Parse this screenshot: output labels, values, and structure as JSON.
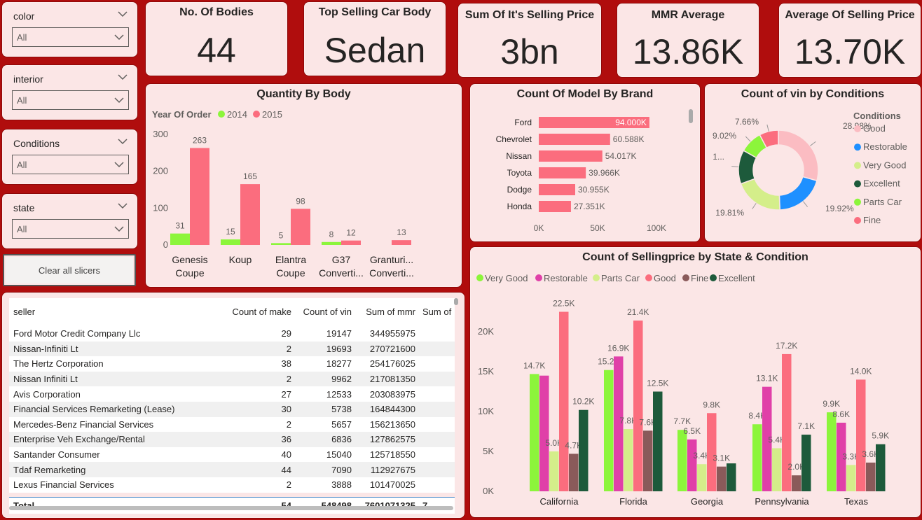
{
  "slicers": [
    {
      "title": "color",
      "value": "All"
    },
    {
      "title": "interior",
      "value": "All"
    },
    {
      "title": "Conditions",
      "value": "All"
    },
    {
      "title": "state",
      "value": "All"
    }
  ],
  "clear_button": "Clear all slicers",
  "kpis": [
    {
      "title": "No. Of Bodies",
      "value": "44"
    },
    {
      "title": "Top Selling Car Body",
      "value": "Sedan"
    },
    {
      "title": "Sum Of It's Selling Price",
      "value": "3bn"
    },
    {
      "title": "MMR Average",
      "value": "13.86K"
    },
    {
      "title": "Average Of Selling Price",
      "value": "13.70K"
    }
  ],
  "chart_data": [
    {
      "type": "bar",
      "title": "Quantity By Body",
      "legend_title": "Year Of Order",
      "categories": [
        "Genesis Coupe",
        "Koup",
        "Elantra Coupe",
        "G37 Converti...",
        "Granturi... Converti..."
      ],
      "category_lines": [
        [
          "Genesis",
          "Coupe"
        ],
        [
          "Koup"
        ],
        [
          "Elantra",
          "Coupe"
        ],
        [
          "G37",
          "Converti..."
        ],
        [
          "Granturi...",
          "Converti..."
        ]
      ],
      "series": [
        {
          "name": "2014",
          "color": "#8cf53b",
          "values": [
            31,
            15,
            5,
            8,
            0
          ],
          "labels": [
            "31",
            "15",
            "5",
            "8",
            ""
          ]
        },
        {
          "name": "2015",
          "color": "#fb6d7e",
          "values": [
            263,
            165,
            98,
            12,
            13
          ],
          "labels": [
            "263",
            "165",
            "98",
            "12",
            "13"
          ]
        }
      ],
      "yticks": [
        "0",
        "100",
        "200",
        "300"
      ],
      "ylim": [
        0,
        300
      ]
    },
    {
      "type": "bar",
      "orientation": "horizontal",
      "title": "Count Of Model By Brand",
      "categories": [
        "Ford",
        "Chevrolet",
        "Nissan",
        "Toyota",
        "Dodge",
        "Honda"
      ],
      "values": [
        94000,
        60588,
        54017,
        39966,
        30955,
        27351
      ],
      "labels": [
        "94.000K",
        "60.588K",
        "54.017K",
        "39.966K",
        "30.955K",
        "27.351K"
      ],
      "xticks": [
        "0K",
        "50K",
        "100K"
      ],
      "xlim": [
        0,
        100000
      ],
      "color": "#fb6d7e"
    },
    {
      "type": "pie",
      "title": "Count of vin by Conditions",
      "legend_title": "Conditions",
      "slices": [
        {
          "name": "Good",
          "value": 28.98,
          "label": "28.98%",
          "color": "#fbbcc2"
        },
        {
          "name": "Restorable",
          "value": 19.92,
          "label": "19.92%",
          "color": "#1e90ff"
        },
        {
          "name": "Very Good",
          "value": 19.81,
          "label": "19.81%",
          "color": "#d4ee8a"
        },
        {
          "name": "Excellent",
          "value": 13.61,
          "label": "1...",
          "color": "#1d5a3b"
        },
        {
          "name": "Parts Car",
          "value": 9.02,
          "label": "9.02%",
          "color": "#8cf53b"
        },
        {
          "name": "Fine",
          "value": 7.66,
          "label": "7.66%",
          "color": "#fb6d7e"
        }
      ]
    },
    {
      "type": "bar",
      "title": "Count of Sellingprice by State & Condition",
      "categories": [
        "California",
        "Florida",
        "Georgia",
        "Pennsylvania",
        "Texas"
      ],
      "series": [
        {
          "name": "Very Good",
          "color": "#8cf53b",
          "values": [
            14700,
            15200,
            7700,
            8400,
            9900
          ],
          "labels": [
            "14.7K",
            "15.2K",
            "7.7K",
            "8.4K",
            "9.9K"
          ]
        },
        {
          "name": "Restorable",
          "color": "#e040a8",
          "values": [
            14500,
            16900,
            6500,
            13100,
            8600
          ],
          "labels": [
            "",
            "16.9K",
            "6.5K",
            "13.1K",
            "8.6K"
          ]
        },
        {
          "name": "Parts Car",
          "color": "#d4ee8a",
          "values": [
            5000,
            7800,
            3400,
            5400,
            3300
          ],
          "labels": [
            "5.0K",
            "7.8K",
            "3.4K",
            "5.4K",
            "3.3K"
          ]
        },
        {
          "name": "Good",
          "color": "#fb6d7e",
          "values": [
            22500,
            21400,
            9800,
            17200,
            14000
          ],
          "labels": [
            "22.5K",
            "21.4K",
            "9.8K",
            "17.2K",
            "14.0K"
          ]
        },
        {
          "name": "Fine",
          "color": "#8a5a5a",
          "values": [
            4700,
            7600,
            3100,
            2000,
            3600
          ],
          "labels": [
            "4.7K",
            "7.6K",
            "3.1K",
            "2.0K",
            "3.6K"
          ]
        },
        {
          "name": "Excellent",
          "color": "#1d5a3b",
          "values": [
            10200,
            12500,
            3500,
            7100,
            5900
          ],
          "labels": [
            "10.2K",
            "12.5K",
            "",
            "7.1K",
            "5.9K"
          ]
        }
      ],
      "yticks": [
        "0K",
        "5K",
        "10K",
        "15K",
        "20K"
      ],
      "ylim": [
        0,
        25000
      ]
    }
  ],
  "table": {
    "columns": [
      "seller",
      "Count of make",
      "Count of vin",
      "Sum of mmr",
      "Sum of"
    ],
    "rows": [
      [
        "Ford Motor Credit Company Llc",
        "29",
        "19147",
        "344955975",
        ""
      ],
      [
        "Nissan-Infiniti Lt",
        "2",
        "19693",
        "270721600",
        ""
      ],
      [
        "The Hertz Corporation",
        "38",
        "18277",
        "254176025",
        ""
      ],
      [
        "Nissan Infiniti Lt",
        "2",
        "9962",
        "217081350",
        ""
      ],
      [
        "Avis Corporation",
        "27",
        "12533",
        "203083975",
        ""
      ],
      [
        "Financial Services Remarketing (Lease)",
        "30",
        "5738",
        "164844300",
        ""
      ],
      [
        "Mercedes-Benz Financial Services",
        "2",
        "5657",
        "156213650",
        ""
      ],
      [
        "Enterprise Veh Exchange/Rental",
        "36",
        "6836",
        "127862575",
        ""
      ],
      [
        "Santander Consumer",
        "40",
        "15040",
        "125718550",
        ""
      ],
      [
        "Tdaf Remarketing",
        "44",
        "7090",
        "112927675",
        ""
      ],
      [
        "Lexus Financial Services",
        "2",
        "3888",
        "101470025",
        ""
      ]
    ],
    "total": [
      "Total",
      "54",
      "548498",
      "7601071325",
      "7"
    ]
  }
}
